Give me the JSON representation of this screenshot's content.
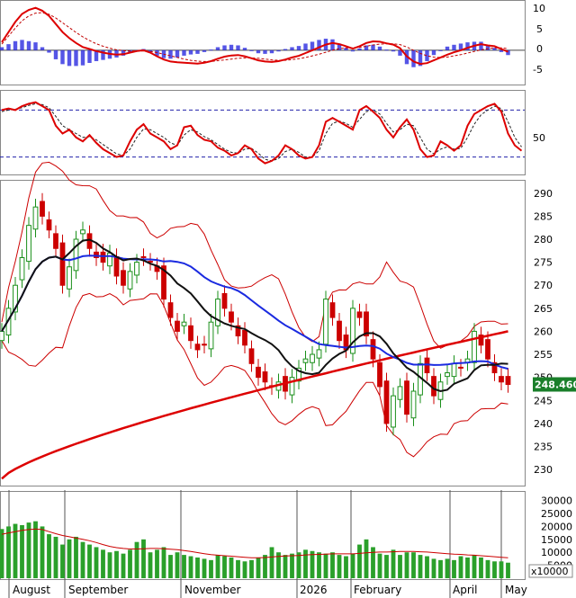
{
  "chart_data": [
    {
      "type": "line",
      "panel": "macd",
      "y_ticks": [
        10,
        5,
        0,
        -5
      ],
      "ylim": [
        -8.5,
        12
      ],
      "series": [
        {
          "values": [
            2.0,
            4.5,
            7.0,
            9.0,
            10.0,
            10.5,
            9.8,
            8.5,
            6.5,
            4.5,
            3.0,
            1.8,
            0.8,
            0.3,
            -0.2,
            -0.6,
            -0.9,
            -1.1,
            -1.0,
            -0.6,
            -0.2,
            0.0,
            -0.6,
            -1.5,
            -2.3,
            -2.8,
            -3.0,
            -3.1,
            -3.2,
            -3.3,
            -3.1,
            -2.7,
            -2.1,
            -1.6,
            -1.3,
            -1.2,
            -1.5,
            -2.0,
            -2.5,
            -2.8,
            -2.9,
            -2.7,
            -2.3,
            -1.8,
            -1.4,
            -0.7,
            0.0,
            0.7,
            1.4,
            1.8,
            1.5,
            1.0,
            0.4,
            1.0,
            1.8,
            2.2,
            2.1,
            1.7,
            1.4,
            0.5,
            -1.5,
            -2.8,
            -3.4,
            -3.2,
            -2.5,
            -1.8,
            -1.1,
            -0.5,
            0.0,
            0.6,
            1.1,
            1.5,
            1.2,
            1.0,
            0.3,
            -0.4
          ]
        },
        {
          "values": [
            1.5,
            3.5,
            5.5,
            7.3,
            8.5,
            9.2,
            9.3,
            8.9,
            8.0,
            6.8,
            5.6,
            4.4,
            3.3,
            2.4,
            1.6,
            1.0,
            0.5,
            0.1,
            -0.1,
            -0.2,
            -0.2,
            -0.2,
            -0.3,
            -0.6,
            -1.0,
            -1.4,
            -1.8,
            -2.2,
            -2.5,
            -2.7,
            -2.8,
            -2.8,
            -2.6,
            -2.4,
            -2.2,
            -2.0,
            -1.9,
            -1.9,
            -2.0,
            -2.2,
            -2.4,
            -2.5,
            -2.5,
            -2.3,
            -2.1,
            -1.8,
            -1.4,
            -1.0,
            -0.5,
            0.0,
            0.4,
            0.6,
            0.6,
            0.7,
            1.0,
            1.3,
            1.5,
            1.6,
            1.6,
            1.4,
            0.8,
            0.0,
            -0.8,
            -1.4,
            -1.7,
            -1.8,
            -1.7,
            -1.4,
            -1.1,
            -0.7,
            -0.3,
            0.1,
            0.4,
            0.6,
            0.6,
            0.4
          ]
        }
      ]
    },
    {
      "type": "line",
      "panel": "stochastic",
      "y_ticks": [
        50
      ],
      "ylim": [
        0,
        100
      ],
      "reference_lines": [
        80,
        20
      ],
      "series": [
        {
          "values": [
            80,
            82,
            80,
            85,
            88,
            90,
            85,
            80,
            60,
            50,
            55,
            45,
            40,
            48,
            38,
            30,
            25,
            20,
            22,
            40,
            55,
            62,
            50,
            45,
            40,
            30,
            35,
            58,
            60,
            48,
            42,
            40,
            32,
            28,
            22,
            25,
            35,
            30,
            18,
            12,
            15,
            22,
            35,
            30,
            22,
            18,
            20,
            35,
            65,
            70,
            65,
            60,
            55,
            80,
            85,
            78,
            70,
            55,
            45,
            58,
            68,
            55,
            30,
            20,
            22,
            40,
            35,
            28,
            35,
            60,
            75,
            80,
            85,
            88,
            78,
            50,
            35,
            28
          ]
        },
        {
          "values": [
            78,
            80,
            81,
            83,
            86,
            88,
            87,
            83,
            72,
            60,
            55,
            50,
            45,
            46,
            42,
            36,
            30,
            24,
            22,
            30,
            45,
            56,
            55,
            50,
            45,
            38,
            35,
            48,
            55,
            52,
            46,
            42,
            36,
            30,
            26,
            25,
            30,
            31,
            25,
            17,
            15,
            18,
            27,
            30,
            26,
            20,
            20,
            28,
            50,
            63,
            66,
            63,
            58,
            68,
            78,
            80,
            75,
            63,
            52,
            55,
            62,
            60,
            45,
            30,
            24,
            30,
            33,
            30,
            31,
            45,
            62,
            74,
            80,
            85,
            82,
            65,
            45,
            33
          ]
        }
      ]
    },
    {
      "type": "candlestick",
      "panel": "price",
      "y_ticks": [
        230,
        235,
        240,
        245,
        250,
        255,
        260,
        265,
        270,
        275,
        280,
        285,
        290
      ],
      "ylim": [
        226.5,
        292.5
      ],
      "x_labels": [
        "August",
        "September",
        "November",
        "2026",
        "February",
        "April",
        "May"
      ],
      "last_price": "248.4600",
      "close": [
        260,
        265,
        270,
        276,
        283,
        287,
        285,
        282,
        278,
        270,
        274,
        280,
        282,
        278,
        276,
        275,
        277,
        272,
        270,
        273,
        275,
        276,
        275,
        273,
        267,
        263,
        260,
        262,
        258,
        256,
        257,
        262,
        267,
        265,
        262,
        259,
        257,
        253,
        250,
        249,
        248,
        249,
        247,
        250,
        252,
        254,
        255,
        256,
        267,
        263,
        258,
        256,
        265,
        263,
        259,
        254,
        248,
        240,
        246,
        248,
        242,
        247,
        253,
        251,
        246,
        249,
        251,
        253,
        252,
        254,
        260,
        257,
        254,
        251,
        249,
        248.46
      ]
    },
    {
      "type": "bar",
      "panel": "volume",
      "y_ticks": [
        5000,
        10000,
        15000,
        20000,
        25000,
        30000
      ],
      "ylim": [
        0,
        33000
      ],
      "scale_note": "x10000",
      "values": [
        19000,
        20000,
        21000,
        20500,
        21500,
        22000,
        20000,
        17000,
        16000,
        13000,
        15000,
        16000,
        14000,
        13000,
        12000,
        11000,
        10000,
        10500,
        9500,
        11000,
        14000,
        15000,
        10000,
        11000,
        12000,
        9000,
        10000,
        9000,
        8500,
        8000,
        7500,
        7000,
        9000,
        8500,
        8000,
        7000,
        6500,
        7000,
        8000,
        9000,
        12000,
        10000,
        9000,
        9500,
        10000,
        11000,
        10500,
        10000,
        9500,
        10000,
        9000,
        8500,
        9500,
        13000,
        15000,
        12000,
        9500,
        9000,
        11000,
        9000,
        10000,
        10000,
        9000,
        8500,
        7500,
        7000,
        7500,
        7000,
        8500,
        8000,
        9000,
        8000,
        7000,
        6500,
        6500,
        6000
      ],
      "moving_average": [
        17000,
        17500,
        18000,
        18500,
        18800,
        19000,
        18800,
        18000,
        17200,
        16500,
        16000,
        15500,
        15000,
        14500,
        13800,
        13000,
        12300,
        11800,
        11500,
        11300,
        11300,
        11400,
        11500,
        11500,
        11400,
        11200,
        11000,
        10700,
        10300,
        9900,
        9500,
        9100,
        8900,
        8700,
        8500,
        8300,
        8100,
        7900,
        7900,
        8000,
        8200,
        8400,
        8600,
        8700,
        8800,
        9000,
        9100,
        9200,
        9300,
        9400,
        9400,
        9400,
        9400,
        9600,
        9800,
        10000,
        10100,
        10100,
        10200,
        10300,
        10300,
        10300,
        10200,
        10100,
        9900,
        9700,
        9500,
        9300,
        9200,
        9000,
        8900,
        8700,
        8500,
        8300,
        8100,
        7900
      ]
    }
  ]
}
